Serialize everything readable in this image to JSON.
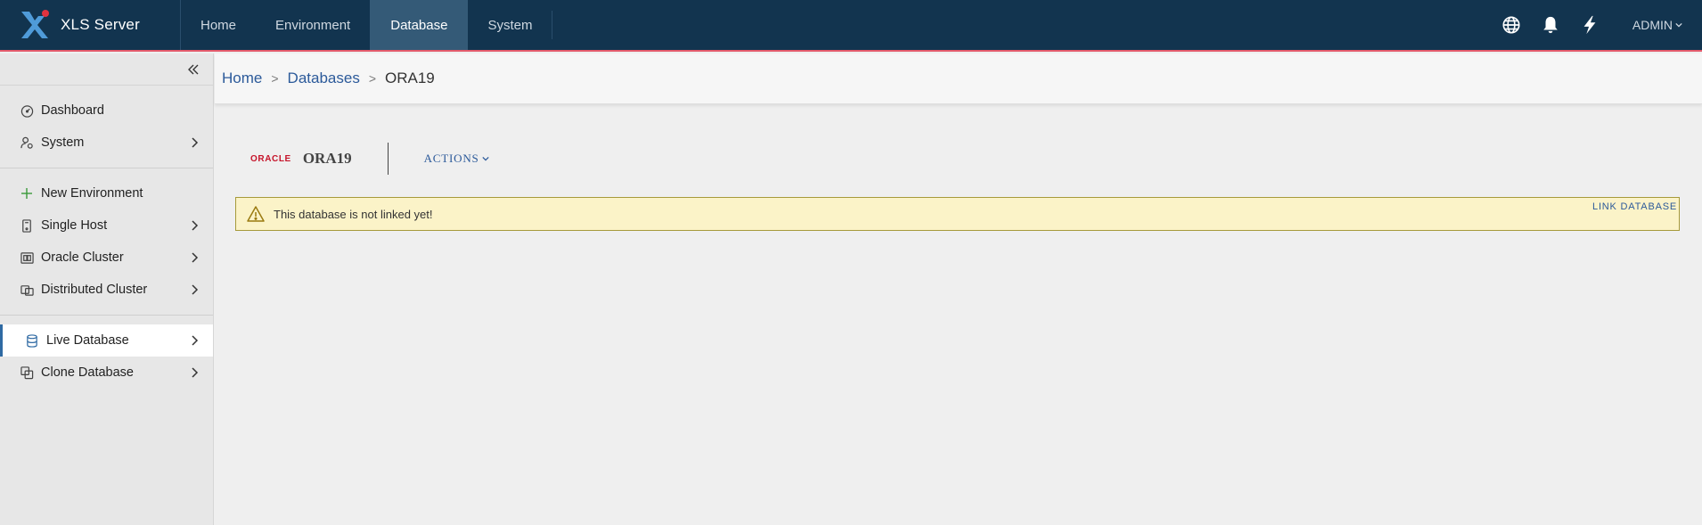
{
  "app": {
    "title": "XLS Server"
  },
  "topnav": {
    "items": [
      {
        "label": "Home",
        "active": false
      },
      {
        "label": "Environment",
        "active": false
      },
      {
        "label": "Database",
        "active": true
      },
      {
        "label": "System",
        "active": false
      }
    ],
    "icons": [
      "globe-icon",
      "bell-icon",
      "lightning-icon"
    ],
    "user": "ADMIN"
  },
  "sidebar": {
    "group1": [
      {
        "label": "Dashboard",
        "icon": "gauge-icon"
      },
      {
        "label": "System",
        "icon": "user-gear-icon"
      }
    ],
    "group2": [
      {
        "label": "New Environment",
        "icon": "plus-icon"
      },
      {
        "label": "Single Host",
        "icon": "server-icon"
      },
      {
        "label": "Oracle Cluster",
        "icon": "cluster-icon"
      },
      {
        "label": "Distributed Cluster",
        "icon": "distributed-icon"
      }
    ],
    "group3": [
      {
        "label": "Live Database",
        "icon": "database-icon",
        "active": true
      },
      {
        "label": "Clone Database",
        "icon": "clone-icon"
      }
    ]
  },
  "breadcrumb": {
    "home": "Home",
    "databases": "Databases",
    "current": "ORA19",
    "separator": ">"
  },
  "database": {
    "vendor_logo": "ORACLE",
    "name": "ORA19",
    "actions_label": "ACTIONS"
  },
  "alert": {
    "message": "This database is not linked yet!",
    "action_label": "LINK DATABASE"
  },
  "colors": {
    "topbar": "#12344f",
    "accent": "#2c5a9a",
    "oracle_red": "#c6152b",
    "alert_bg": "#fbf3c8"
  }
}
